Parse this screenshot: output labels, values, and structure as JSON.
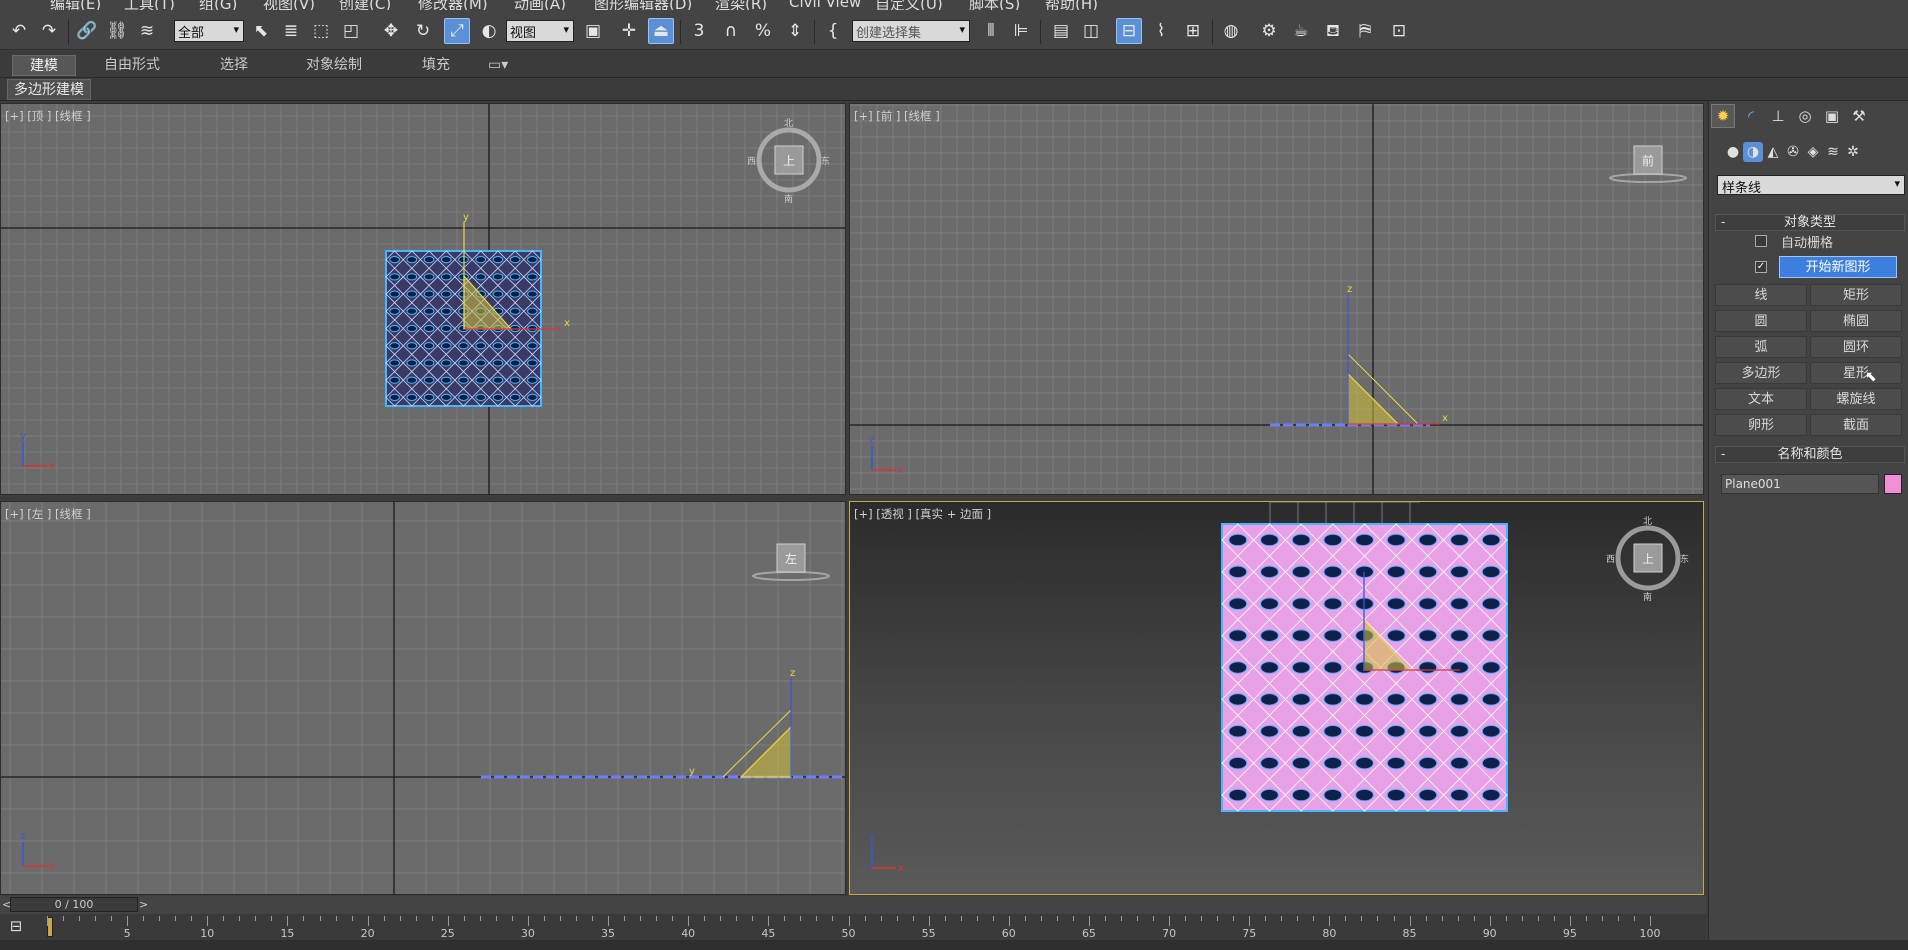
{
  "menu": {
    "items": [
      "编辑(E)",
      "工具(T)",
      "组(G)",
      "视图(V)",
      "创建(C)",
      "修改器(M)",
      "动画(A)",
      "图形编辑器(D)",
      "渲染(R)",
      "Civil View",
      "自定义(U)",
      "脚本(S)",
      "帮助(H)"
    ]
  },
  "toolbar": {
    "selection_filter": "全部",
    "ref_coord": "视图",
    "named_selection_placeholder": "创建选择集",
    "snap_labels": {
      "snap3": "3",
      "angle": "",
      "percent": "%",
      "spinner": ""
    }
  },
  "ribbon": {
    "tabs": [
      "建模",
      "自由形式",
      "选择",
      "对象绘制",
      "填充"
    ],
    "active_tab": "建模",
    "subtab": "多边形建模"
  },
  "viewports": {
    "top": {
      "label": "[+] [顶 ] [线框 ]",
      "cube_face": "上"
    },
    "front": {
      "label": "[+] [前 ] [线框 ]",
      "cube_face": "前"
    },
    "left": {
      "label": "[+] [左 ] [线框 ]",
      "cube_face": "左"
    },
    "persp": {
      "label": "[+] [透视 ] [真实 + 边面 ]",
      "cube_face": "上"
    }
  },
  "axes": {
    "x": "x",
    "y": "y",
    "z": "z"
  },
  "compass": {
    "north": "北",
    "south": "南",
    "east": "东",
    "west": "西"
  },
  "command_panel": {
    "category_dropdown": "样条线",
    "rollout_object_type": "对象类型",
    "auto_grid_label": "自动栅格",
    "start_new_shape_label": "开始新图形",
    "shape_buttons": [
      "线",
      "矩形",
      "圆",
      "椭圆",
      "弧",
      "圆环",
      "多边形",
      "星形",
      "文本",
      "螺旋线",
      "卵形",
      "截面"
    ],
    "rollout_name_color": "名称和颜色",
    "object_name": "Plane001",
    "object_color": "#f08fd6"
  },
  "timeline": {
    "frame_display": "0 / 100",
    "prev_arrow": "<",
    "next_arrow": ">",
    "ticks": [
      "5",
      "10",
      "15",
      "20",
      "25",
      "30",
      "35",
      "40",
      "45",
      "50",
      "55",
      "60",
      "65",
      "70",
      "75",
      "80",
      "85",
      "90",
      "95",
      "100"
    ]
  },
  "colors": {
    "accent": "#5b8fd6",
    "viewport_bg": "#6b6b6b",
    "grid_line": "#7d7d7d",
    "object_pink": "#e8a0e6",
    "selection_blue": "#44b8ff",
    "triangle_yellow": "#d6c23a"
  }
}
